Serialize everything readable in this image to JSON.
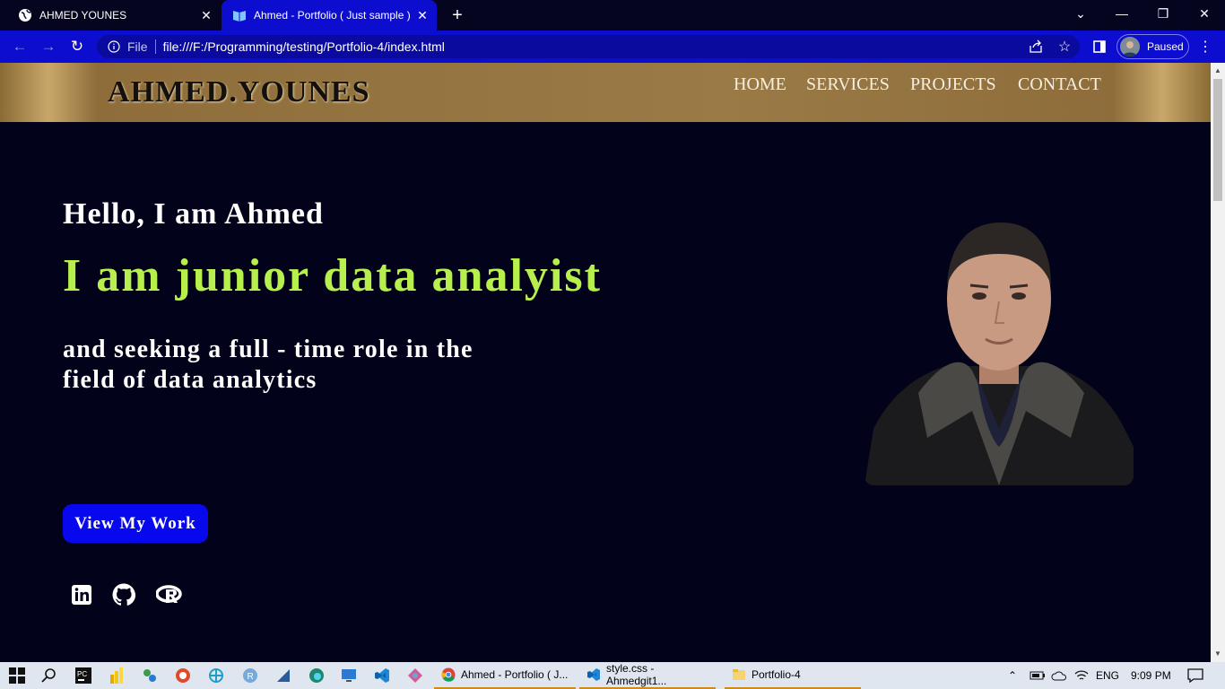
{
  "browser": {
    "tabs": [
      {
        "label": "AHMED YOUNES",
        "icon": "globe-icon"
      },
      {
        "label": "Ahmed - Portfolio ( Just sample )",
        "icon": "book-icon"
      }
    ],
    "address": {
      "scheme": "File",
      "url": "file:///F:/Programming/testing/Portfolio-4/index.html"
    },
    "profile_label": "Paused"
  },
  "site": {
    "logo": "AHMED.YOUNES",
    "nav": [
      "HOME",
      "SERVICES",
      "PROJECTS",
      "CONTACT"
    ],
    "hero": {
      "greeting": "Hello, I am Ahmed",
      "title": "I am junior data analyist",
      "subtitle_line1": "and seeking a full - time role in the",
      "subtitle_line2": "field of data analytics",
      "cta": "View My Work"
    },
    "social": [
      "linkedin-icon",
      "github-icon",
      "r-icon"
    ]
  },
  "taskbar": {
    "apps": [
      {
        "label": "Ahmed - Portfolio ( J...",
        "icon": "chrome-icon"
      },
      {
        "label": "style.css - Ahmedgit1...",
        "icon": "vscode-icon"
      },
      {
        "label": "Portfolio-4",
        "icon": "folder-icon"
      }
    ],
    "lang": "ENG",
    "time": "9:09 PM"
  },
  "colors": {
    "accent": "#0d0dcf",
    "title_green": "#b7f04c",
    "cta_blue": "#0808ee",
    "header_gold": "#93733f"
  }
}
